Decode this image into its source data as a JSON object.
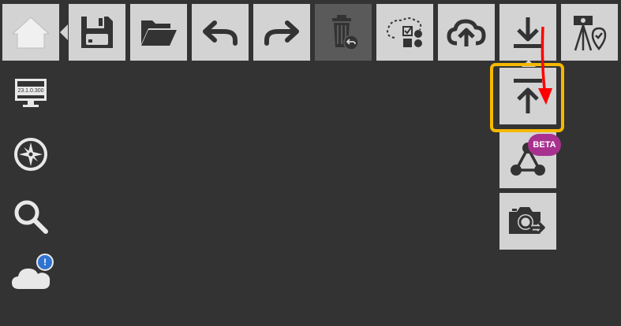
{
  "toolbar": {
    "buttons": [
      {
        "name": "home-button",
        "icon": "home-icon"
      },
      {
        "name": "save-button",
        "icon": "floppy-disk-icon"
      },
      {
        "name": "open-button",
        "icon": "folder-open-icon"
      },
      {
        "name": "undo-button",
        "icon": "undo-arrow-icon"
      },
      {
        "name": "redo-button",
        "icon": "redo-arrow-icon"
      },
      {
        "name": "restore-deleted-button",
        "icon": "trash-restore-icon",
        "state": "disabled"
      },
      {
        "name": "select-objects-button",
        "icon": "lasso-select-icon"
      },
      {
        "name": "upload-cloud-button",
        "icon": "cloud-upload-icon"
      },
      {
        "name": "download-button",
        "icon": "download-arrow-icon"
      },
      {
        "name": "survey-location-button",
        "icon": "survey-tripod-location-icon"
      }
    ]
  },
  "sidebar": {
    "monitor": {
      "icon": "monitor-icon",
      "version": "23.1.0.300"
    },
    "compass": {
      "icon": "compass-icon"
    },
    "search": {
      "icon": "search-icon"
    },
    "cloud": {
      "icon": "cloud-icon",
      "badge": "!"
    }
  },
  "submenu": {
    "items": [
      {
        "name": "upload-item",
        "icon": "upload-arrow-icon",
        "highlighted": true
      },
      {
        "name": "beta-network-item",
        "icon": "network-triangle-icon",
        "badge": "BETA"
      },
      {
        "name": "screenshot-export-item",
        "icon": "camera-search-export-icon"
      }
    ]
  },
  "colors": {
    "background": "#333333",
    "button": "#d3d3d3",
    "icon": "#333333",
    "disabled_button": "#5a5a5a",
    "highlight": "#f5b800",
    "annotation_arrow": "#ff0000",
    "beta_badge": "#a8318f",
    "notification_badge": "#2f74d0"
  }
}
